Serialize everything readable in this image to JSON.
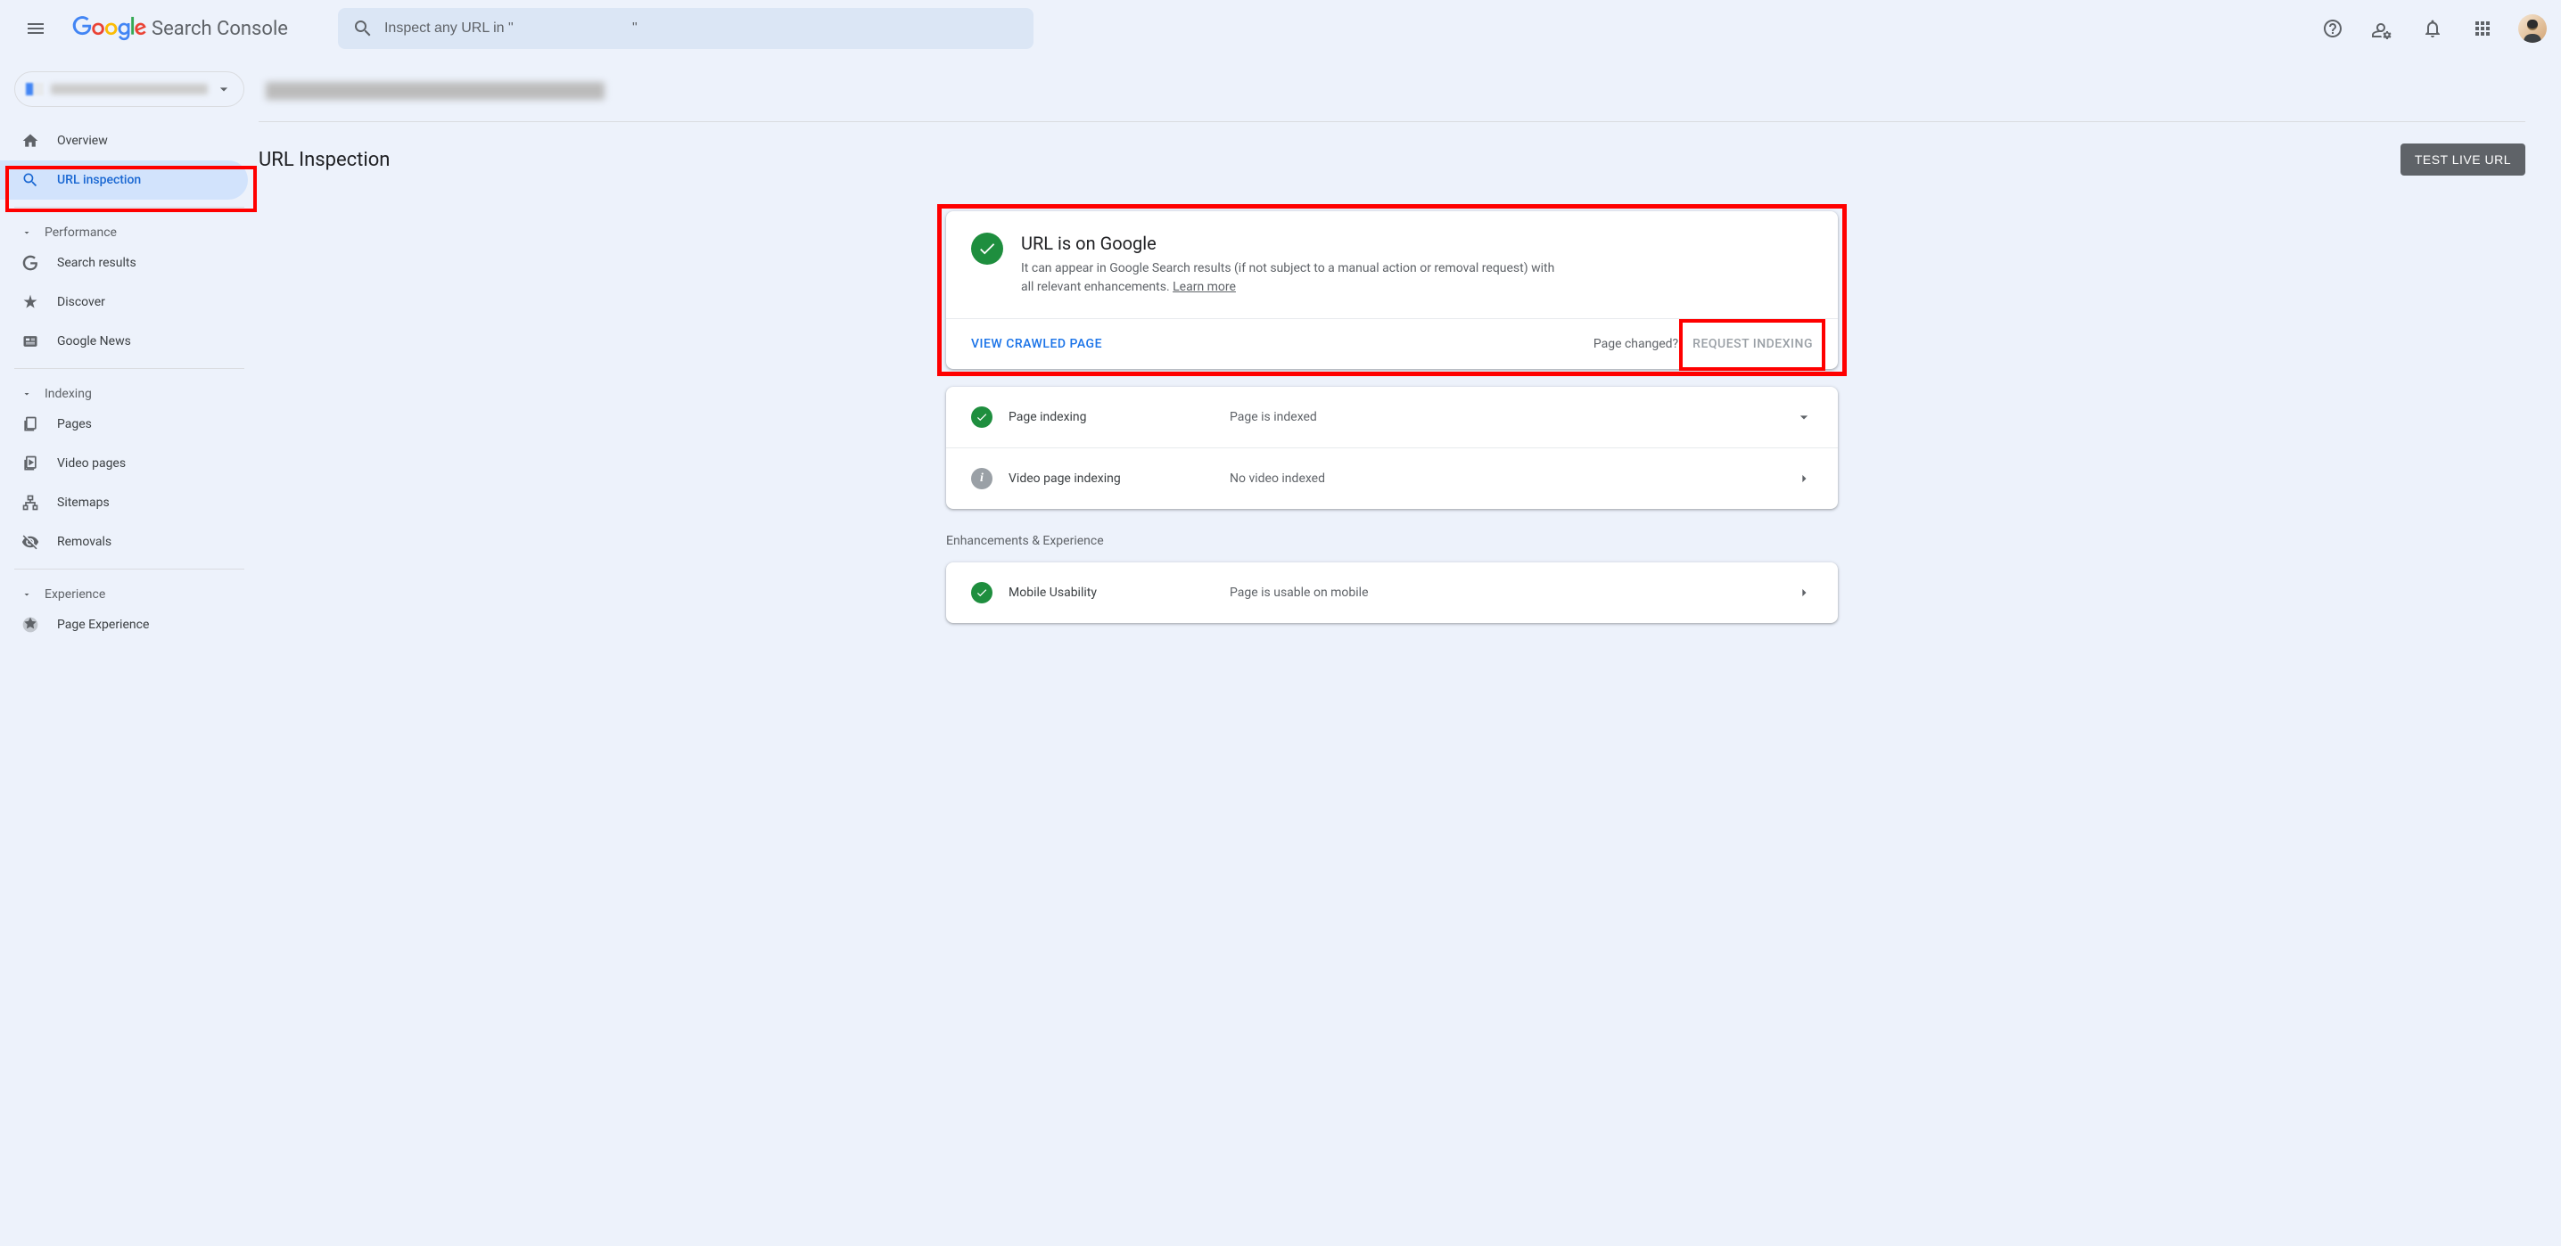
{
  "header": {
    "logo_text": "Search Console",
    "search_placeholder": "Inspect any URL in \"                              \""
  },
  "sidebar": {
    "overview": "Overview",
    "url_inspection": "URL inspection",
    "sections": {
      "performance": "Performance",
      "indexing": "Indexing",
      "experience": "Experience"
    },
    "items": {
      "search_results": "Search results",
      "discover": "Discover",
      "google_news": "Google News",
      "pages": "Pages",
      "video_pages": "Video pages",
      "sitemaps": "Sitemaps",
      "removals": "Removals",
      "page_experience": "Page Experience"
    }
  },
  "main": {
    "title": "URL Inspection",
    "test_live": "TEST LIVE URL",
    "status_card": {
      "title": "URL is on Google",
      "desc": "It can appear in Google Search results (if not subject to a manual action or removal request) with all relevant enhancements. ",
      "learn_more": "Learn more",
      "view_crawled": "VIEW CRAWLED PAGE",
      "page_changed": "Page changed?",
      "request_indexing": "REQUEST INDEXING"
    },
    "details": [
      {
        "label": "Page indexing",
        "value": "Page is indexed",
        "icon": "check"
      },
      {
        "label": "Video page indexing",
        "value": "No video indexed",
        "icon": "info"
      }
    ],
    "enhancements_label": "Enhancements & Experience",
    "enhancements": [
      {
        "label": "Mobile Usability",
        "value": "Page is usable on mobile",
        "icon": "check"
      }
    ]
  }
}
